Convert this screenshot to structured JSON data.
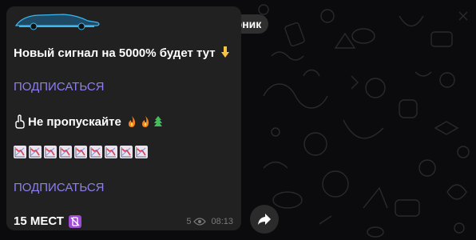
{
  "date_badge": "вторник",
  "message": {
    "line1": "Новый сигнал на 5000% будет тут",
    "line1_emoji_name": "pointing-down-hand-icon",
    "subscribe_1": "ПОДПИСАТЬСЯ",
    "line2": "Не пропускайте",
    "line2_prefix_emoji_name": "pointing-up-hand-icon",
    "line2_suffix_emojis": [
      "fire-icon",
      "fire-icon",
      "tree-icon"
    ],
    "chart_emoji_count": 9,
    "chart_emoji_name": "chart-decreasing-icon",
    "subscribe_2": "ПОДПИСАТЬСЯ",
    "line3": "15 МЕСТ",
    "line3_emoji_name": "no-mobile-phones-icon",
    "views": "5",
    "time": "08:13"
  },
  "colors": {
    "bubble": "#212121",
    "link": "#8d7ff0",
    "text": "#ffffff",
    "meta": "#7a7a7a",
    "background": "#0b0b0d"
  },
  "forward_icon": "share-arrow-icon"
}
